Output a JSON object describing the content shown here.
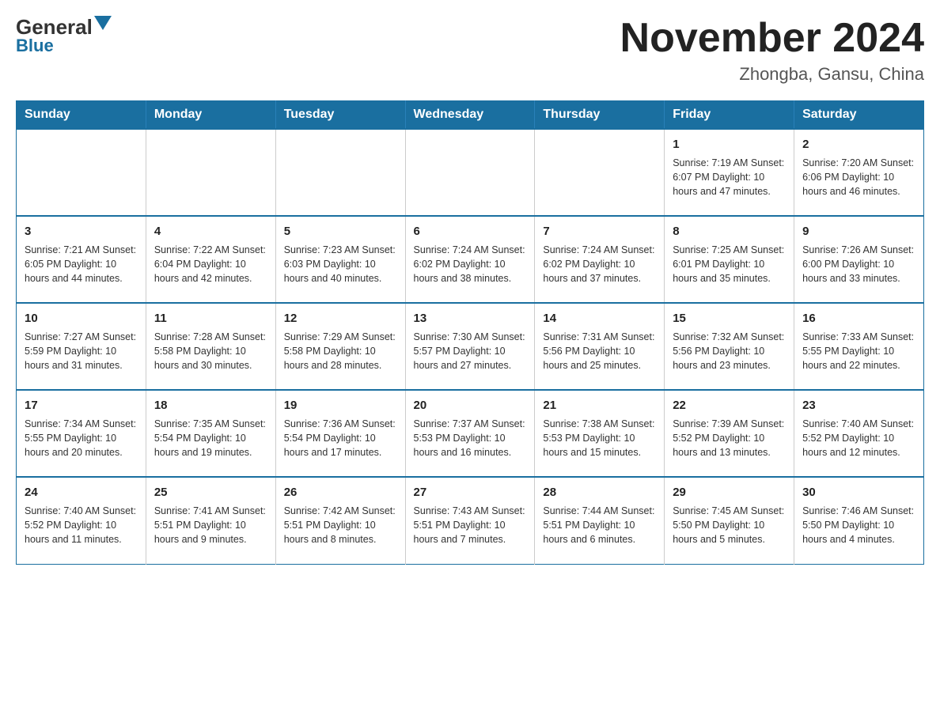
{
  "logo": {
    "general": "General",
    "blue": "Blue"
  },
  "title": "November 2024",
  "subtitle": "Zhongba, Gansu, China",
  "weekdays": [
    "Sunday",
    "Monday",
    "Tuesday",
    "Wednesday",
    "Thursday",
    "Friday",
    "Saturday"
  ],
  "weeks": [
    [
      {
        "day": "",
        "info": ""
      },
      {
        "day": "",
        "info": ""
      },
      {
        "day": "",
        "info": ""
      },
      {
        "day": "",
        "info": ""
      },
      {
        "day": "",
        "info": ""
      },
      {
        "day": "1",
        "info": "Sunrise: 7:19 AM\nSunset: 6:07 PM\nDaylight: 10 hours and 47 minutes."
      },
      {
        "day": "2",
        "info": "Sunrise: 7:20 AM\nSunset: 6:06 PM\nDaylight: 10 hours and 46 minutes."
      }
    ],
    [
      {
        "day": "3",
        "info": "Sunrise: 7:21 AM\nSunset: 6:05 PM\nDaylight: 10 hours and 44 minutes."
      },
      {
        "day": "4",
        "info": "Sunrise: 7:22 AM\nSunset: 6:04 PM\nDaylight: 10 hours and 42 minutes."
      },
      {
        "day": "5",
        "info": "Sunrise: 7:23 AM\nSunset: 6:03 PM\nDaylight: 10 hours and 40 minutes."
      },
      {
        "day": "6",
        "info": "Sunrise: 7:24 AM\nSunset: 6:02 PM\nDaylight: 10 hours and 38 minutes."
      },
      {
        "day": "7",
        "info": "Sunrise: 7:24 AM\nSunset: 6:02 PM\nDaylight: 10 hours and 37 minutes."
      },
      {
        "day": "8",
        "info": "Sunrise: 7:25 AM\nSunset: 6:01 PM\nDaylight: 10 hours and 35 minutes."
      },
      {
        "day": "9",
        "info": "Sunrise: 7:26 AM\nSunset: 6:00 PM\nDaylight: 10 hours and 33 minutes."
      }
    ],
    [
      {
        "day": "10",
        "info": "Sunrise: 7:27 AM\nSunset: 5:59 PM\nDaylight: 10 hours and 31 minutes."
      },
      {
        "day": "11",
        "info": "Sunrise: 7:28 AM\nSunset: 5:58 PM\nDaylight: 10 hours and 30 minutes."
      },
      {
        "day": "12",
        "info": "Sunrise: 7:29 AM\nSunset: 5:58 PM\nDaylight: 10 hours and 28 minutes."
      },
      {
        "day": "13",
        "info": "Sunrise: 7:30 AM\nSunset: 5:57 PM\nDaylight: 10 hours and 27 minutes."
      },
      {
        "day": "14",
        "info": "Sunrise: 7:31 AM\nSunset: 5:56 PM\nDaylight: 10 hours and 25 minutes."
      },
      {
        "day": "15",
        "info": "Sunrise: 7:32 AM\nSunset: 5:56 PM\nDaylight: 10 hours and 23 minutes."
      },
      {
        "day": "16",
        "info": "Sunrise: 7:33 AM\nSunset: 5:55 PM\nDaylight: 10 hours and 22 minutes."
      }
    ],
    [
      {
        "day": "17",
        "info": "Sunrise: 7:34 AM\nSunset: 5:55 PM\nDaylight: 10 hours and 20 minutes."
      },
      {
        "day": "18",
        "info": "Sunrise: 7:35 AM\nSunset: 5:54 PM\nDaylight: 10 hours and 19 minutes."
      },
      {
        "day": "19",
        "info": "Sunrise: 7:36 AM\nSunset: 5:54 PM\nDaylight: 10 hours and 17 minutes."
      },
      {
        "day": "20",
        "info": "Sunrise: 7:37 AM\nSunset: 5:53 PM\nDaylight: 10 hours and 16 minutes."
      },
      {
        "day": "21",
        "info": "Sunrise: 7:38 AM\nSunset: 5:53 PM\nDaylight: 10 hours and 15 minutes."
      },
      {
        "day": "22",
        "info": "Sunrise: 7:39 AM\nSunset: 5:52 PM\nDaylight: 10 hours and 13 minutes."
      },
      {
        "day": "23",
        "info": "Sunrise: 7:40 AM\nSunset: 5:52 PM\nDaylight: 10 hours and 12 minutes."
      }
    ],
    [
      {
        "day": "24",
        "info": "Sunrise: 7:40 AM\nSunset: 5:52 PM\nDaylight: 10 hours and 11 minutes."
      },
      {
        "day": "25",
        "info": "Sunrise: 7:41 AM\nSunset: 5:51 PM\nDaylight: 10 hours and 9 minutes."
      },
      {
        "day": "26",
        "info": "Sunrise: 7:42 AM\nSunset: 5:51 PM\nDaylight: 10 hours and 8 minutes."
      },
      {
        "day": "27",
        "info": "Sunrise: 7:43 AM\nSunset: 5:51 PM\nDaylight: 10 hours and 7 minutes."
      },
      {
        "day": "28",
        "info": "Sunrise: 7:44 AM\nSunset: 5:51 PM\nDaylight: 10 hours and 6 minutes."
      },
      {
        "day": "29",
        "info": "Sunrise: 7:45 AM\nSunset: 5:50 PM\nDaylight: 10 hours and 5 minutes."
      },
      {
        "day": "30",
        "info": "Sunrise: 7:46 AM\nSunset: 5:50 PM\nDaylight: 10 hours and 4 minutes."
      }
    ]
  ]
}
